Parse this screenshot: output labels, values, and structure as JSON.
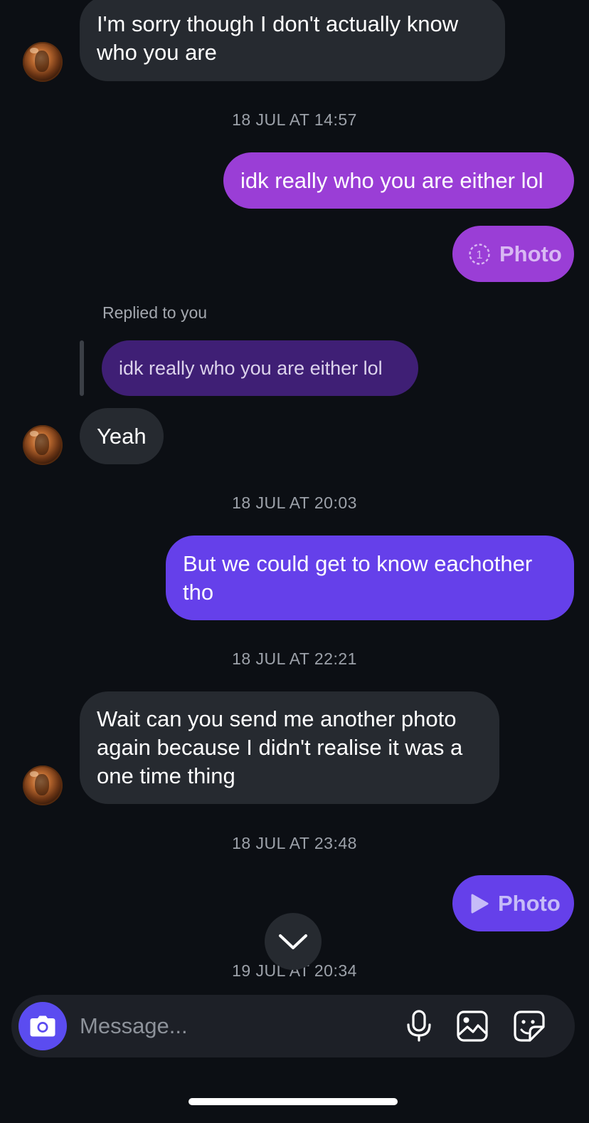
{
  "messages": {
    "m1": "I'm sorry though I don't actually know who you are",
    "ts1": "18 JUL AT 14:57",
    "m2": "idk really who you are either lol",
    "m3_photo": "Photo",
    "reply_label": "Replied to you",
    "reply_quote": "idk really who you are either lol",
    "m4": "Yeah",
    "ts2": "18 JUL AT 20:03",
    "m5": "But we could get to know eachother tho",
    "ts3": "18 JUL AT 22:21",
    "m6": "Wait can you send me another photo again because I didn't realise it was a one time thing",
    "ts4": "18 JUL AT 23:48",
    "m7_photo": "Photo",
    "ts5": "19 JUL AT 20:34"
  },
  "composer": {
    "placeholder": "Message..."
  },
  "icons": {
    "avatar": "contact-avatar",
    "view_once": "view-once-icon",
    "play": "play-icon",
    "scroll_down": "chevron-down-icon",
    "camera": "camera-icon",
    "mic": "microphone-icon",
    "gallery": "gallery-icon",
    "sticker": "sticker-icon"
  },
  "colors": {
    "background": "#0c0f14",
    "incoming_bubble": "#262a30",
    "outgoing_pink": "#9a3ed6",
    "outgoing_indigo": "#6540ea",
    "reply_bubble": "#3f1f75",
    "camera_button": "#5b4cf0"
  }
}
